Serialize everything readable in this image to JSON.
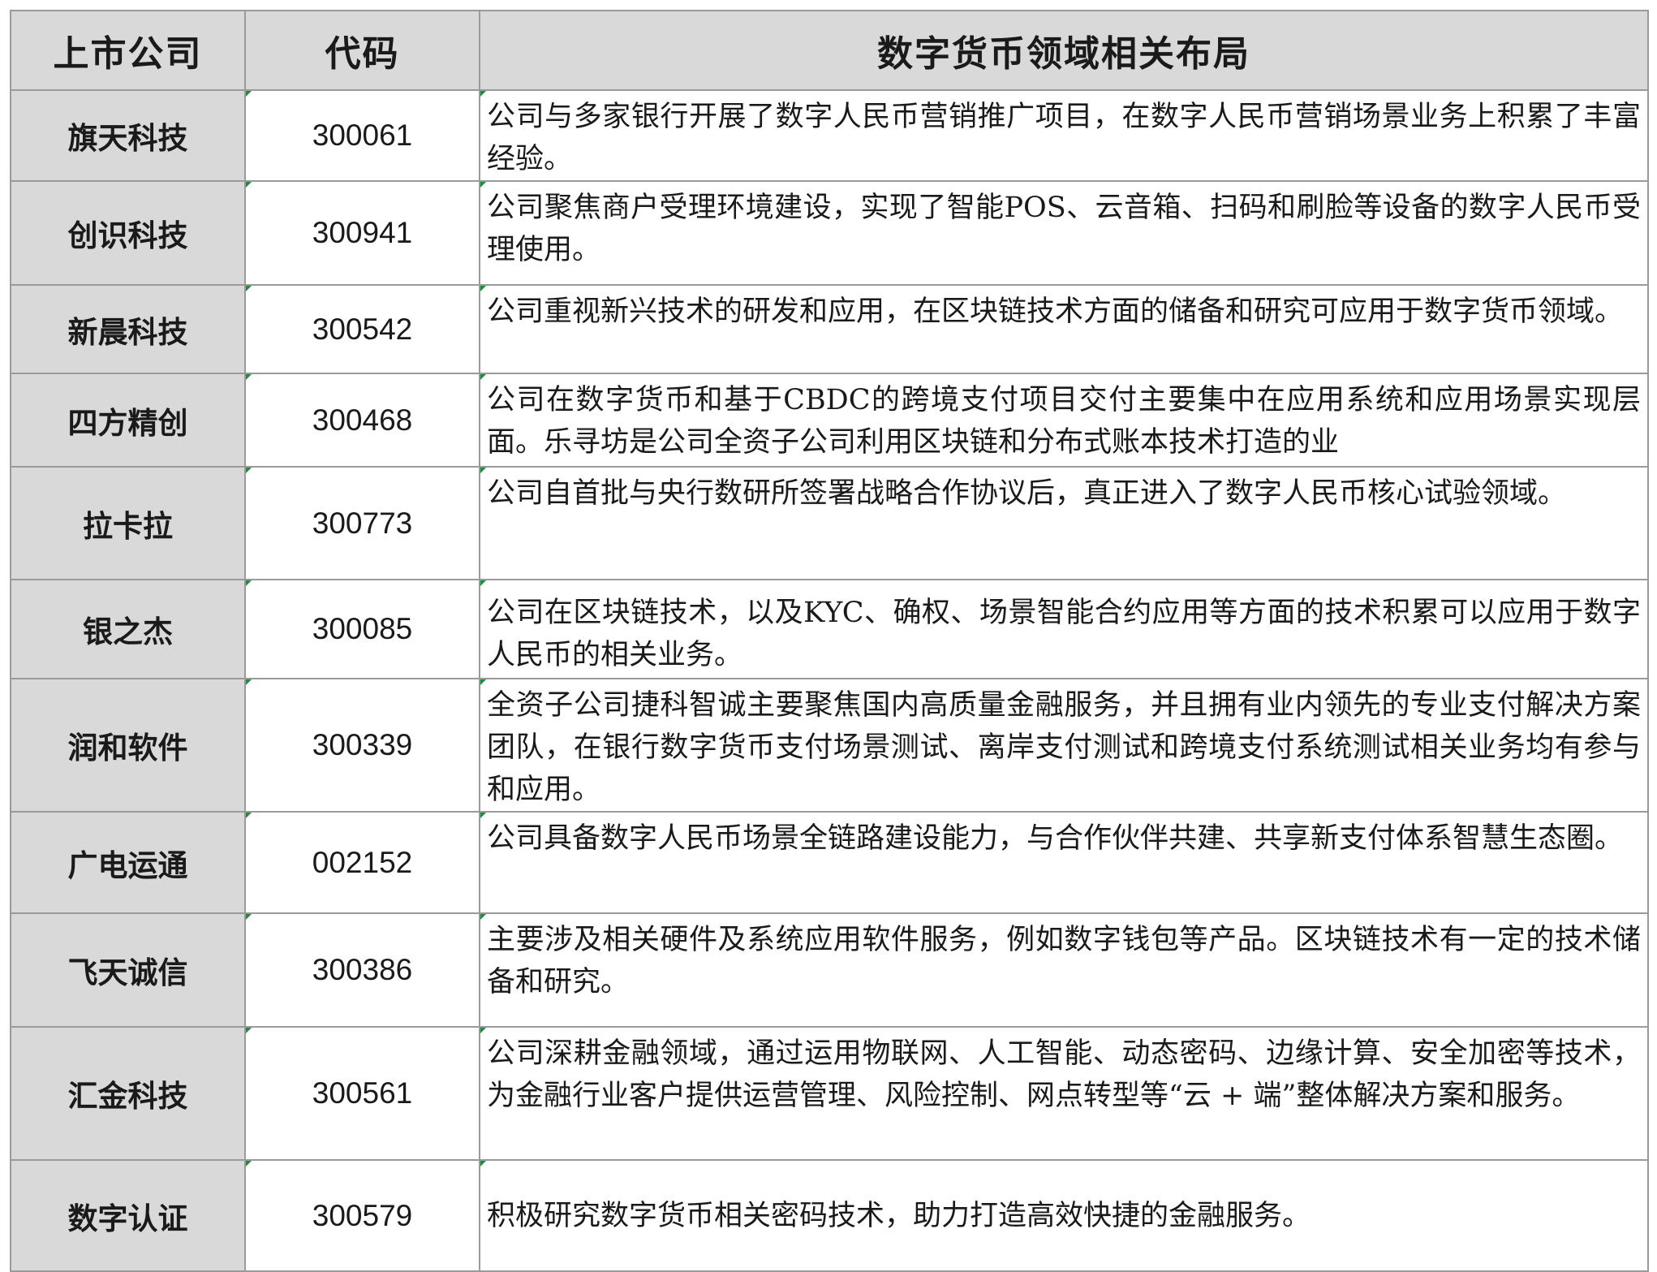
{
  "header": {
    "company": "上市公司",
    "code": "代码",
    "layout": "数字货币领域相关布局"
  },
  "rows": [
    {
      "company": "旗天科技",
      "code": "300061",
      "desc": "公司与多家银行开展了数字人民币营销推广项目，在数字人民币营销场景业务上积累了丰富经验。"
    },
    {
      "company": "创识科技",
      "code": "300941",
      "desc": "公司聚焦商户受理环境建设，实现了智能POS、云音箱、扫码和刷脸等设备的数字人民币受理使用。"
    },
    {
      "company": "新晨科技",
      "code": "300542",
      "desc": "公司重视新兴技术的研发和应用，在区块链技术方面的储备和研究可应用于数字货币领域。"
    },
    {
      "company": "四方精创",
      "code": "300468",
      "desc": "公司在数字货币和基于CBDC的跨境支付项目交付主要集中在应用系统和应用场景实现层面。乐寻坊是公司全资子公司利用区块链和分布式账本技术打造的业"
    },
    {
      "company": "拉卡拉",
      "code": "300773",
      "desc": "公司自首批与央行数研所签署战略合作协议后，真正进入了数字人民币核心试验领域。"
    },
    {
      "company": "银之杰",
      "code": "300085",
      "desc": "公司在区块链技术，以及KYC、确权、场景智能合约应用等方面的技术积累可以应用于数字人民币的相关业务。"
    },
    {
      "company": "润和软件",
      "code": "300339",
      "desc": "全资子公司捷科智诚主要聚焦国内高质量金融服务，并且拥有业内领先的专业支付解决方案团队，在银行数字货币支付场景测试、离岸支付测试和跨境支付系统测试相关业务均有参与和应用。"
    },
    {
      "company": "广电运通",
      "code": "002152",
      "desc": "公司具备数字人民币场景全链路建设能力，与合作伙伴共建、共享新支付体系智慧生态圈。"
    },
    {
      "company": "飞天诚信",
      "code": "300386",
      "desc": "主要涉及相关硬件及系统应用软件服务，例如数字钱包等产品。区块链技术有一定的技术储备和研究。"
    },
    {
      "company": "汇金科技",
      "code": "300561",
      "desc": "公司深耕金融领域，通过运用物联网、人工智能、动态密码、边缘计算、安全加密等技术，为金融行业客户提供运营管理、风险控制、网点转型等“云 + 端”整体解决方案和服务。"
    },
    {
      "company": "数字认证",
      "code": "300579",
      "desc": "积极研究数字货币相关密码技术，助力打造高效快捷的金融服务。"
    }
  ]
}
